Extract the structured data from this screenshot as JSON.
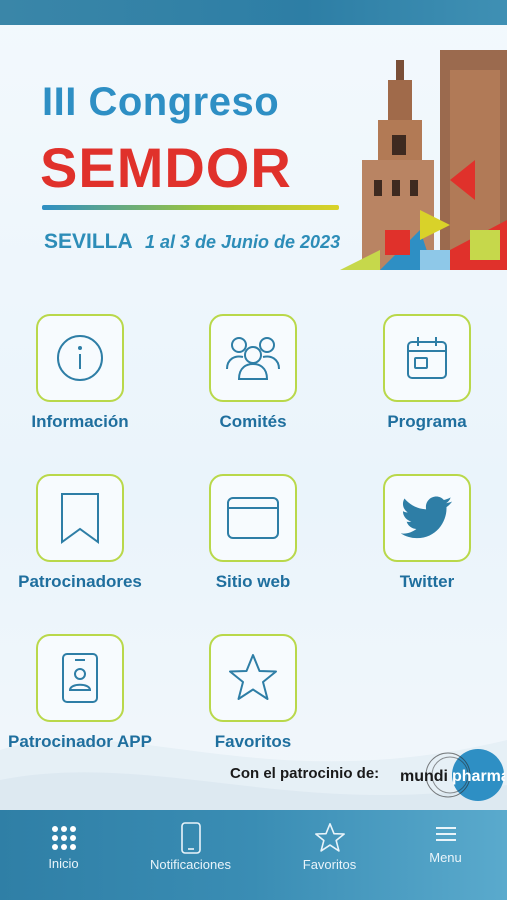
{
  "header": {
    "title_line1": "III Congreso",
    "title_line2": "SEMDOR",
    "city": "SEVILLA",
    "dates": "1 al 3 de Junio de 2023"
  },
  "menu": {
    "items": [
      {
        "label": "Información",
        "icon": "info-icon"
      },
      {
        "label": "Comités",
        "icon": "people-icon"
      },
      {
        "label": "Programa",
        "icon": "calendar-icon"
      },
      {
        "label": "Patrocinadores",
        "icon": "bookmark-icon"
      },
      {
        "label": "Sitio web",
        "icon": "browser-window-icon"
      },
      {
        "label": "Twitter",
        "icon": "twitter-bird-icon"
      },
      {
        "label": "Patrocinador APP",
        "icon": "id-badge-icon"
      },
      {
        "label": "Favoritos",
        "icon": "star-icon"
      }
    ]
  },
  "sponsor": {
    "text": "Con el patrocinio de:",
    "logo_left": "mundi",
    "logo_right": "pharma"
  },
  "tabbar": {
    "items": [
      {
        "label": "Inicio",
        "icon": "grid-dots-icon"
      },
      {
        "label": "Notificaciones",
        "icon": "phone-icon"
      },
      {
        "label": "Favoritos",
        "icon": "star-outline-icon"
      },
      {
        "label": "Menu",
        "icon": "hamburger-icon"
      }
    ]
  },
  "colors": {
    "accent_blue": "#2e8fc4",
    "accent_red": "#e0312b",
    "tile_border": "#b9d84a",
    "label_blue": "#1f6f9e",
    "tabbar": "#3a8db4"
  }
}
